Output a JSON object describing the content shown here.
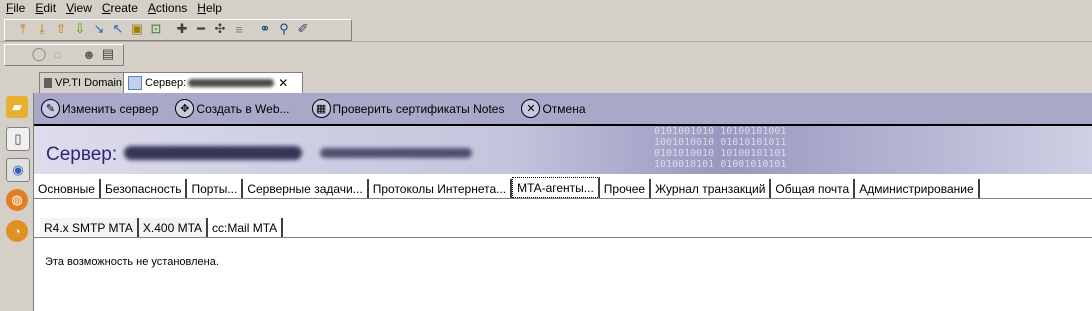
{
  "menu": [
    "File",
    "Edit",
    "View",
    "Create",
    "Actions",
    "Help"
  ],
  "doc_tabs": [
    {
      "label": "VP.TI Domain",
      "active": false
    },
    {
      "label": "Сервер: ",
      "active": true,
      "close": "✕"
    }
  ],
  "actions": [
    {
      "label": "Изменить сервер",
      "icon": "✎"
    },
    {
      "label": "Создать в Web...",
      "icon": "✥"
    },
    {
      "label": "Проверить сертификаты Notes",
      "icon": "▦"
    },
    {
      "label": "Отмена",
      "icon": "✕"
    }
  ],
  "banner": {
    "title": "Сервер:",
    "bits": "0101001010 10100101001\n1001010010 01010101011\n0101010010 10100101101\n1010010101 01001010101"
  },
  "main_tabs": [
    {
      "label": "Основные",
      "active": false
    },
    {
      "label": "Безопасность",
      "active": false
    },
    {
      "label": "Порты...",
      "active": false
    },
    {
      "label": "Серверные задачи...",
      "active": false
    },
    {
      "label": "Протоколы Интернета...",
      "active": false
    },
    {
      "label": "MTA-агенты...",
      "active": true
    },
    {
      "label": "Прочее",
      "active": false
    },
    {
      "label": "Журнал транзакций",
      "active": false
    },
    {
      "label": "Общая почта",
      "active": false
    },
    {
      "label": "Администрирование",
      "active": false
    }
  ],
  "sub_tabs": [
    {
      "label": "R4.x SMTP MTA",
      "active": false
    },
    {
      "label": "X.400 MTA",
      "active": false
    },
    {
      "label": "cc:Mail MTA",
      "active": true
    }
  ],
  "message": "Эта возможность не установлена.",
  "colors": {
    "action_bar": "#a8a8c8",
    "banner_title": "#282878"
  }
}
